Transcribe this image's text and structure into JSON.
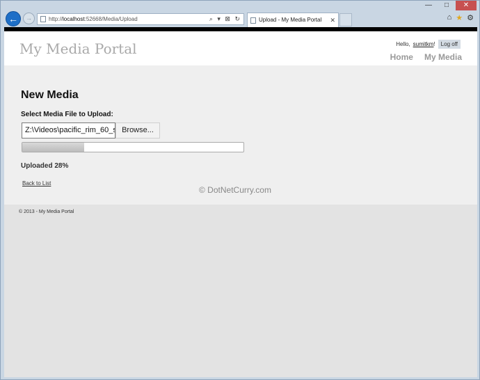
{
  "browser": {
    "caption": {
      "minimize": "—",
      "maximize": "□",
      "close": "✕"
    },
    "address": {
      "prefix": "http://",
      "host": "localhost",
      "rest": ":52668/Media/Upload",
      "tools": "⌕ ▾ ⊠ ↻"
    },
    "tab": {
      "title": "Upload - My Media Portal",
      "close": "✕"
    },
    "icons": {
      "home": "⌂",
      "favorites": "★",
      "settings": "⚙"
    }
  },
  "site": {
    "title": "My Media Portal",
    "greeting": "Hello,",
    "username": "sumitkm",
    "greeting_suffix": "!",
    "logoff_label": "Log off",
    "nav": [
      "Home",
      "My Media"
    ]
  },
  "upload": {
    "heading": "New Media",
    "file_label": "Select Media File to Upload:",
    "file_value": "Z:\\Videos\\pacific_rim_60_s",
    "browse_label": "Browse...",
    "progress_fraction": 0.28,
    "status_text": "Uploaded 28%",
    "back_link": "Back to List"
  },
  "watermark": "© DotNetCurry.com",
  "footer": {
    "copyright": "© 2013 - My Media Portal"
  },
  "colors": {
    "accent": "#1e6fc7",
    "close": "#c75050"
  }
}
